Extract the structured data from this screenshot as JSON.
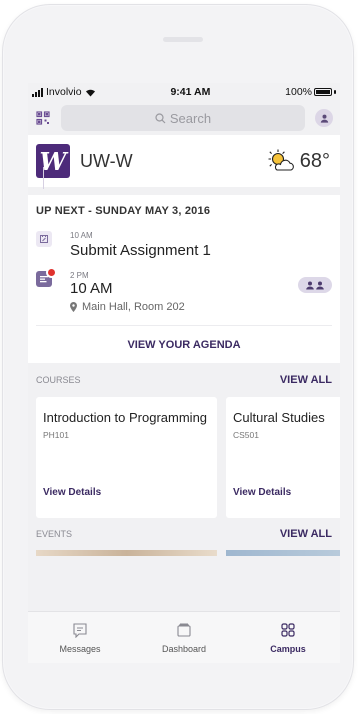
{
  "status_bar": {
    "carrier": "Involvio",
    "time": "9:41 AM",
    "battery": "100%",
    "battery_level": 1.0
  },
  "search": {
    "placeholder": "Search"
  },
  "header": {
    "logo_letter": "W",
    "university": "UW-W",
    "temperature": "68°",
    "weather_icon": "partly-sunny-icon"
  },
  "up_next": {
    "title": "UP NEXT - SUNDAY MAY 3, 2016",
    "events": [
      {
        "time": "10 AM",
        "title": "Submit Assignment 1"
      },
      {
        "time": "2 PM",
        "title": "10 AM",
        "location": "Main Hall, Room 202"
      }
    ],
    "agenda_link": "VIEW YOUR AGENDA"
  },
  "courses": {
    "label": "COURSES",
    "view_all": "VIEW ALL",
    "items": [
      {
        "title": "Introduction to Programming",
        "code": "PH101",
        "link": "View Details"
      },
      {
        "title": "Cultural Studies",
        "code": "CS501",
        "link": "View Details"
      }
    ]
  },
  "events": {
    "label": "EVENTS",
    "view_all": "VIEW ALL"
  },
  "tabs": [
    {
      "label": "Messages",
      "icon": "message-icon",
      "active": false
    },
    {
      "label": "Dashboard",
      "icon": "dashboard-icon",
      "active": false
    },
    {
      "label": "Campus",
      "icon": "grid-icon",
      "active": true
    }
  ],
  "colors": {
    "brand": "#4d2b7a",
    "accent": "#3b2a62",
    "alert": "#e0322e"
  }
}
